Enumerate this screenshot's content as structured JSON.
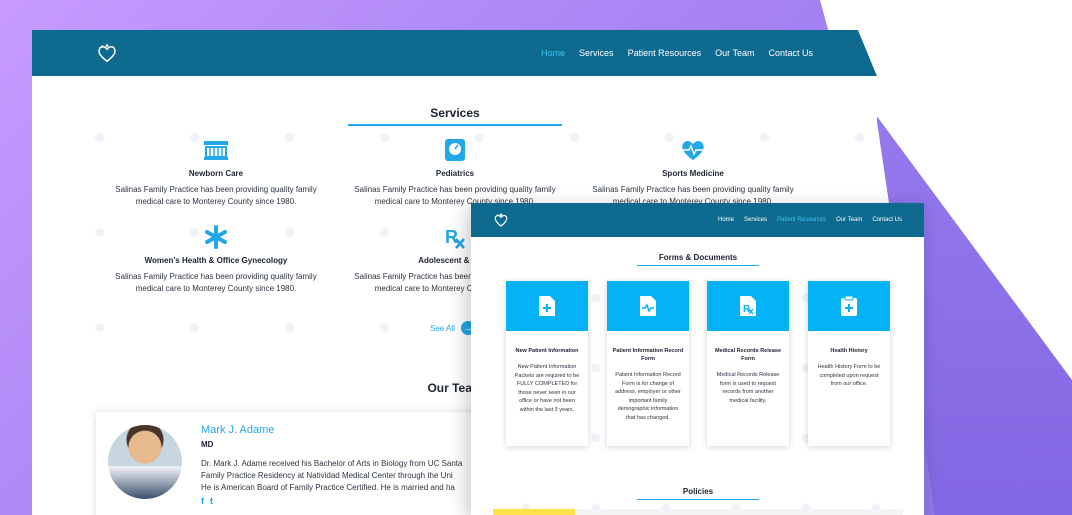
{
  "back_site": {
    "nav": {
      "items": [
        {
          "label": "Home",
          "active": true
        },
        {
          "label": "Services",
          "active": false
        },
        {
          "label": "Patient Resources",
          "active": false
        },
        {
          "label": "Our Team",
          "active": false
        },
        {
          "label": "Contact Us",
          "active": false
        }
      ]
    },
    "services_title": "Services",
    "services": [
      {
        "name": "Newborn Care",
        "desc": "Salinas Family Practice has been providing quality family medical care to Monterey County since 1980.",
        "icon": "crib-icon"
      },
      {
        "name": "Pediatrics",
        "desc": "Salinas Family Practice has been providing quality family medical care to Monterey County since 1980.",
        "icon": "scale-icon"
      },
      {
        "name": "Sports Medicine",
        "desc": "Salinas Family Practice has been providing quality family medical care to Monterey County since 1980.",
        "icon": "heartbeat-icon"
      },
      {
        "name": "Women’s Health & Office Gynecology",
        "desc": "Salinas Family Practice has been providing quality family medical care to Monterey County since 1980.",
        "icon": "asterisk-icon"
      },
      {
        "name": "Adolescent & Adult",
        "desc": "Salinas Family Practice has been providing quality family medical care to Monterey County since 1980.",
        "icon": "rx-icon"
      }
    ],
    "see_all": "See All",
    "team_title": "Our Team",
    "team": {
      "name": "Mark J. Adame",
      "role": "MD",
      "bio": [
        "Dr. Mark J. Adame received his Bachelor of Arts in Biology from UC Santa",
        "Family Practice Residency at Natividad Medical Center through the Uni",
        "He is American Board of Family Practice Certified. He is married and ha"
      ],
      "social": [
        "f",
        "t"
      ]
    }
  },
  "front_site": {
    "nav": {
      "items": [
        {
          "label": "Home",
          "active": false
        },
        {
          "label": "Services",
          "active": false
        },
        {
          "label": "Patient Resources",
          "active": true
        },
        {
          "label": "Our Team",
          "active": false
        },
        {
          "label": "Contact Us",
          "active": false
        }
      ]
    },
    "forms_title": "Forms & Documents",
    "forms": [
      {
        "title": "New Patient Information",
        "desc": "New Patient Information Packets are required to be FULLY COMPLETED for those never seen in our office or have not been within the last 3 years.",
        "icon": "document-plus-icon"
      },
      {
        "title": "Patient Information Record Form",
        "desc": "Patient Information Record Form is for change of address, employer or other important family demographic information that has changed.",
        "icon": "document-pulse-icon"
      },
      {
        "title": "Medical Records Release Form",
        "desc": "Medical Records Release form is used to request records from another medical facility.",
        "icon": "document-rx-icon"
      },
      {
        "title": "Health History",
        "desc": "Health History Form to be completed upon request from our office.",
        "icon": "clipboard-plus-icon"
      }
    ],
    "policies_title": "Policies"
  },
  "colors": {
    "nav_bg": "#0f6a8f",
    "accent": "#22a7e8",
    "card_top": "#03b3f5",
    "bg_purple": "#a883f3"
  }
}
